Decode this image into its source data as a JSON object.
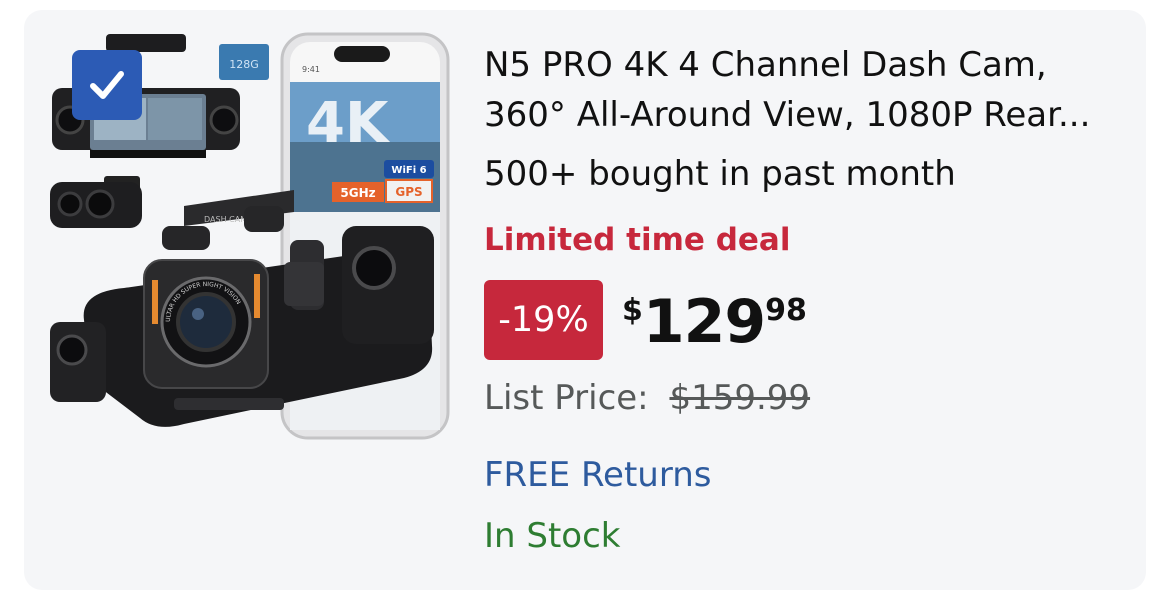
{
  "product": {
    "title_line1": "N5 PRO 4K 4 Channel Dash Cam,",
    "title_line2": "360° All-Around View, 1080P Rear...",
    "bought": "500+ bought in past month",
    "deal_label": "Limited time deal",
    "discount": "-19%",
    "price_symbol": "$",
    "price_whole": "129",
    "price_fraction": "98",
    "list_price_label": "List Price:",
    "list_price_value": "$159.99",
    "returns": "FREE Returns",
    "stock": "In Stock",
    "selected": true
  },
  "image": {
    "phone_time": "9:41",
    "badge_4k": "4K",
    "badge_wifi": "WiFi 6",
    "badge_5ghz": "5GHz",
    "badge_gps": "GPS",
    "sd_card": "128G",
    "camera_label": "DASH CAMERA",
    "lens_ring": "ULTAR HD SUPER NIGHT VISION"
  },
  "colors": {
    "deal_red": "#c7283c",
    "link_blue": "#2e5b9e",
    "stock_green": "#2e7d32",
    "checkbox_blue": "#2c5bb5"
  }
}
